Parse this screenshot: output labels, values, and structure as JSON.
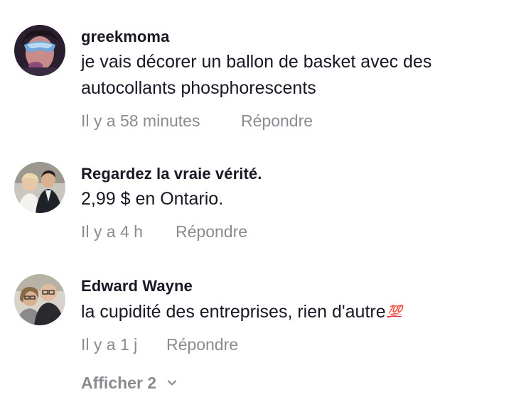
{
  "comments": [
    {
      "username": "greekmoma",
      "text": "je vais décorer un ballon de basket avec des autocollants phosphorescents",
      "time": "Il y a 58 minutes",
      "reply_label": "Répondre"
    },
    {
      "username": "Regardez la vraie vérité.",
      "text": "2,99 $ en Ontario.",
      "time": "Il y a 4 h",
      "reply_label": "Répondre"
    },
    {
      "username": "Edward Wayne",
      "text": "la cupidité des entreprises, rien d'autre",
      "emoji": "💯",
      "time": "Il y a 1 j",
      "reply_label": "Répondre"
    }
  ],
  "show_more": {
    "label": "Afficher 2",
    "icon": "chevron-down-icon"
  },
  "colors": {
    "primary_text": "#161823",
    "secondary_text": "#8a8b91",
    "emoji_red": "#e0245e"
  }
}
